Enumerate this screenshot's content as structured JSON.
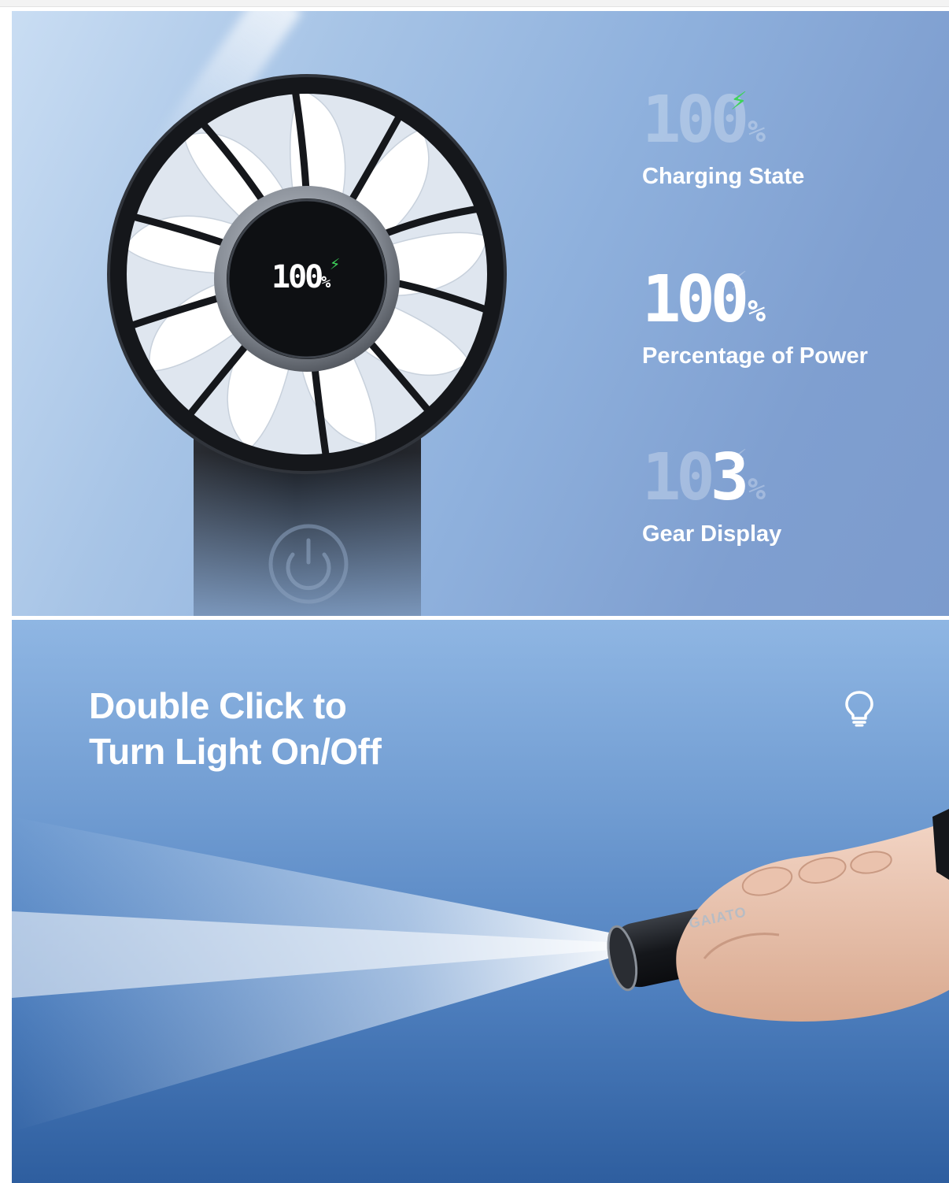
{
  "panel1": {
    "specs": [
      {
        "digits": "100",
        "percent": "%",
        "label": "Charging State"
      },
      {
        "digits": "100",
        "percent": "%",
        "label": "Percentage of Power"
      },
      {
        "digits_ghost": "10",
        "digits_active": "3",
        "percent": "%",
        "label": "Gear Display"
      }
    ],
    "fan_display": {
      "value": "100",
      "percent": "%"
    }
  },
  "panel2": {
    "headline_line1": "Double Click to",
    "headline_line2": "Turn Light On/Off",
    "brand_text": "GAIATO"
  },
  "colors": {
    "charge_bolt": "#3ed35a",
    "panel_text": "#ffffff"
  },
  "icons": [
    "lightning-bolt-icon",
    "light-bulb-icon",
    "power-button-icon"
  ]
}
